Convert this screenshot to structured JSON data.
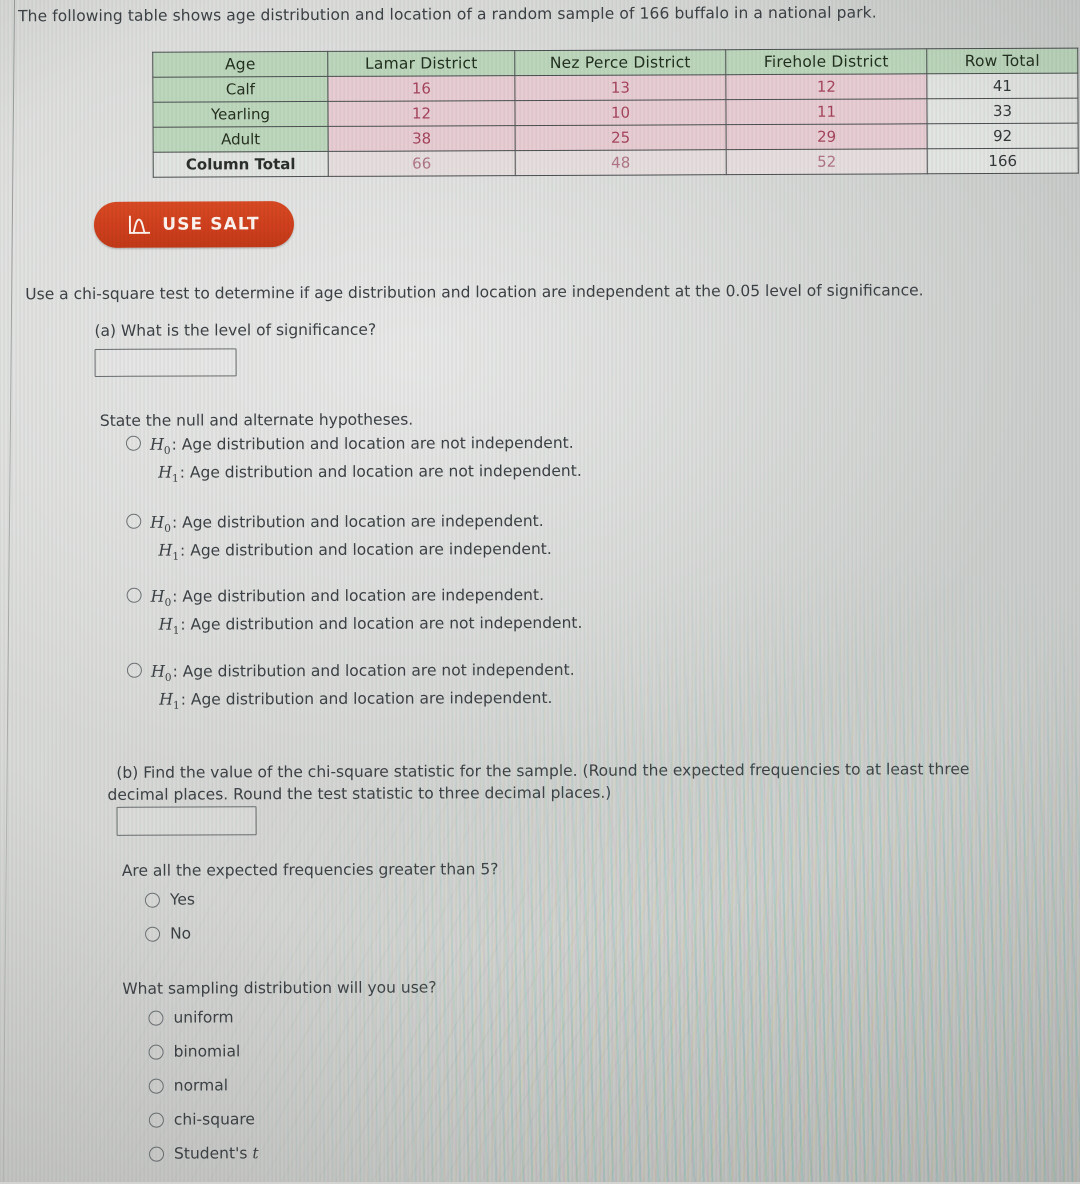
{
  "intro": "The following table shows age distribution and location of a random sample of 166 buffalo in a national park.",
  "table": {
    "headers": [
      "Age",
      "Lamar District",
      "Nez Perce District",
      "Firehole District",
      "Row Total"
    ],
    "rows": [
      {
        "label": "Calf",
        "values": [
          "16",
          "13",
          "12"
        ],
        "row_total": "41"
      },
      {
        "label": "Yearling",
        "values": [
          "12",
          "10",
          "11"
        ],
        "row_total": "33"
      },
      {
        "label": "Adult",
        "values": [
          "38",
          "25",
          "29"
        ],
        "row_total": "92"
      },
      {
        "label": "Column Total",
        "values": [
          "66",
          "48",
          "52"
        ],
        "row_total": "166"
      }
    ],
    "colors": {
      "header_bg": "#bcd6bc",
      "row_label_bg": "#bdd7bd",
      "value_bg": "#e7cdd3",
      "value_text": "#a6445c",
      "total_bg": "#e3e5e2",
      "border": "#4b4f50"
    }
  },
  "salt_button": {
    "label": "USE SALT",
    "icon": "distribution-curve-icon",
    "bg_color": "#cf3f1d",
    "text_color": "#fdf4ef"
  },
  "lead_text": "Use a chi-square test to determine if age distribution and location are independent at the 0.05 level of significance.",
  "part_a": {
    "question": "(a) What is the level of significance?",
    "answer_value": "",
    "state_label": "State the null and alternate hypotheses.",
    "options": [
      {
        "h0": "Age distribution and location are not independent.",
        "h1": "Age distribution and location are not independent.",
        "selected": false
      },
      {
        "h0": "Age distribution and location are independent.",
        "h1": "Age distribution and location are independent.",
        "selected": false
      },
      {
        "h0": "Age distribution and location are independent.",
        "h1": "Age distribution and location are not independent.",
        "selected": false
      },
      {
        "h0": "Age distribution and location are not independent.",
        "h1": "Age distribution and location are independent.",
        "selected": false
      }
    ],
    "h0_symbol": "H",
    "h0_sub": "0",
    "h1_symbol": "H",
    "h1_sub": "1",
    "colon": ":"
  },
  "part_b": {
    "question_line1": "(b) Find the value of the chi-square statistic for the sample. (Round the expected frequencies to at least three",
    "question_line2": "decimal places. Round the test statistic to three decimal places.)",
    "answer_value": ""
  },
  "expected_freq": {
    "question": "Are all the expected frequencies greater than 5?",
    "options": [
      {
        "label": "Yes",
        "selected": false
      },
      {
        "label": "No",
        "selected": false
      }
    ]
  },
  "sampling_distribution": {
    "question": "What sampling distribution will you use?",
    "options": [
      {
        "label": "uniform",
        "selected": false,
        "italic_tail": ""
      },
      {
        "label": "binomial",
        "selected": false,
        "italic_tail": ""
      },
      {
        "label": "normal",
        "selected": false,
        "italic_tail": ""
      },
      {
        "label": "chi-square",
        "selected": false,
        "italic_tail": ""
      },
      {
        "label": "Student's",
        "selected": false,
        "italic_tail": "t"
      }
    ]
  }
}
